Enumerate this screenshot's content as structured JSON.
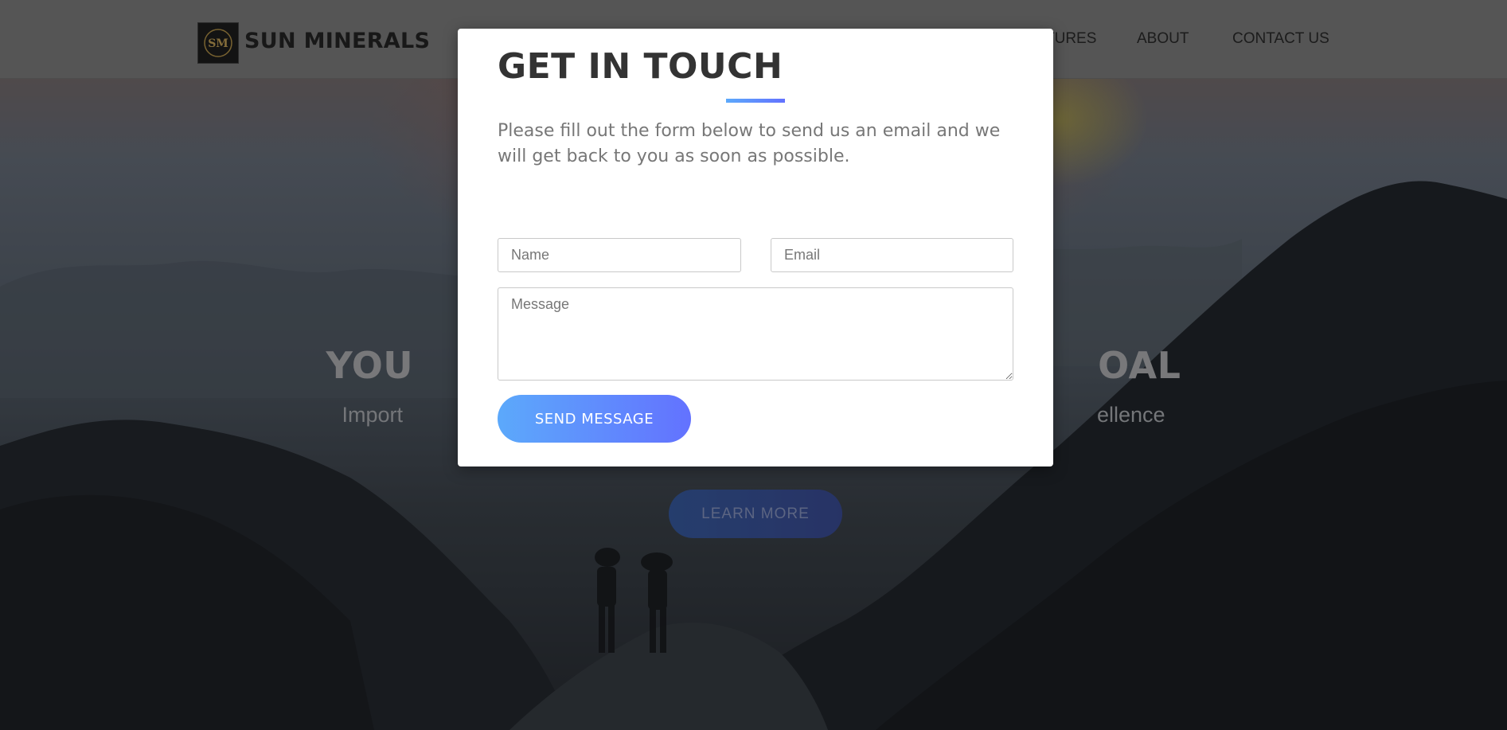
{
  "navbar": {
    "brand": "SUN MINERALS",
    "links": [
      "TURES",
      "ABOUT",
      "CONTACT US"
    ]
  },
  "hero": {
    "title_left": "YOU",
    "title_right": "OAL",
    "subtitle_left": "Import",
    "subtitle_right": "ellence",
    "button_label": "LEARN MORE"
  },
  "modal": {
    "title": "GET IN TOUCH",
    "description": "Please fill out the form below to send us an email and we will get back to you as soon as possible.",
    "name_placeholder": "Name",
    "email_placeholder": "Email",
    "message_placeholder": "Message",
    "send_label": "SEND MESSAGE"
  },
  "colors": {
    "accent_start": "#5ca9fb",
    "accent_end": "#6372ff"
  },
  "icons": {
    "logo": "sm-logo-icon",
    "resize": "resize-handle-icon"
  }
}
